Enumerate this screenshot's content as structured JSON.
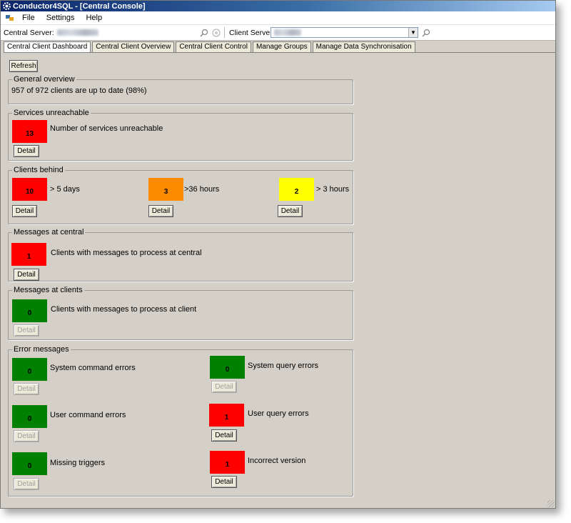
{
  "window": {
    "title": "Conductor4SQL - [Central Console]"
  },
  "menu": {
    "items": [
      "File",
      "Settings",
      "Help"
    ]
  },
  "toolbar": {
    "central_label": "Central Server:",
    "client_label": "Client Servers:"
  },
  "tabs": [
    "Central Client Dashboard",
    "Central Client Overview",
    "Central Client Control",
    "Manage Groups",
    "Manage Data Synchronisation"
  ],
  "active_tab": "Central Client Dashboard",
  "refresh_label": "Refresh",
  "detail_label": "Detail",
  "general": {
    "title": "General overview",
    "summary": "957 of 972 clients are up to date (98%)"
  },
  "services": {
    "title": "Services unreachable",
    "count": "13",
    "label": "Number of services unreachable",
    "color": "#ff0000"
  },
  "clients_behind": {
    "title": "Clients behind",
    "items": [
      {
        "count": "10",
        "label": "> 5 days",
        "color": "#ff0000"
      },
      {
        "count": "3",
        "label": ">36 hours",
        "color": "#ff8c00"
      },
      {
        "count": "2",
        "label": "> 3 hours",
        "color": "#ffff00"
      }
    ]
  },
  "messages_central": {
    "title": "Messages at central",
    "count": "1",
    "label": "Clients with messages to process at central",
    "color": "#ff0000"
  },
  "messages_clients": {
    "title": "Messages at clients",
    "count": "0",
    "label": "Clients with messages to process at client",
    "color": "#008000"
  },
  "errors": {
    "title": "Error messages",
    "items": [
      {
        "count": "0",
        "label": "System command errors",
        "color": "#008000",
        "detail_enabled": false
      },
      {
        "count": "0",
        "label": "System query errors",
        "color": "#008000",
        "detail_enabled": false
      },
      {
        "count": "0",
        "label": "User command errors",
        "color": "#008000",
        "detail_enabled": false
      },
      {
        "count": "1",
        "label": "User query errors",
        "color": "#ff0000",
        "detail_enabled": true
      },
      {
        "count": "0",
        "label": "Missing triggers",
        "color": "#008000",
        "detail_enabled": false
      },
      {
        "count": "1",
        "label": "Incorrect version",
        "color": "#ff0000",
        "detail_enabled": true
      }
    ]
  }
}
